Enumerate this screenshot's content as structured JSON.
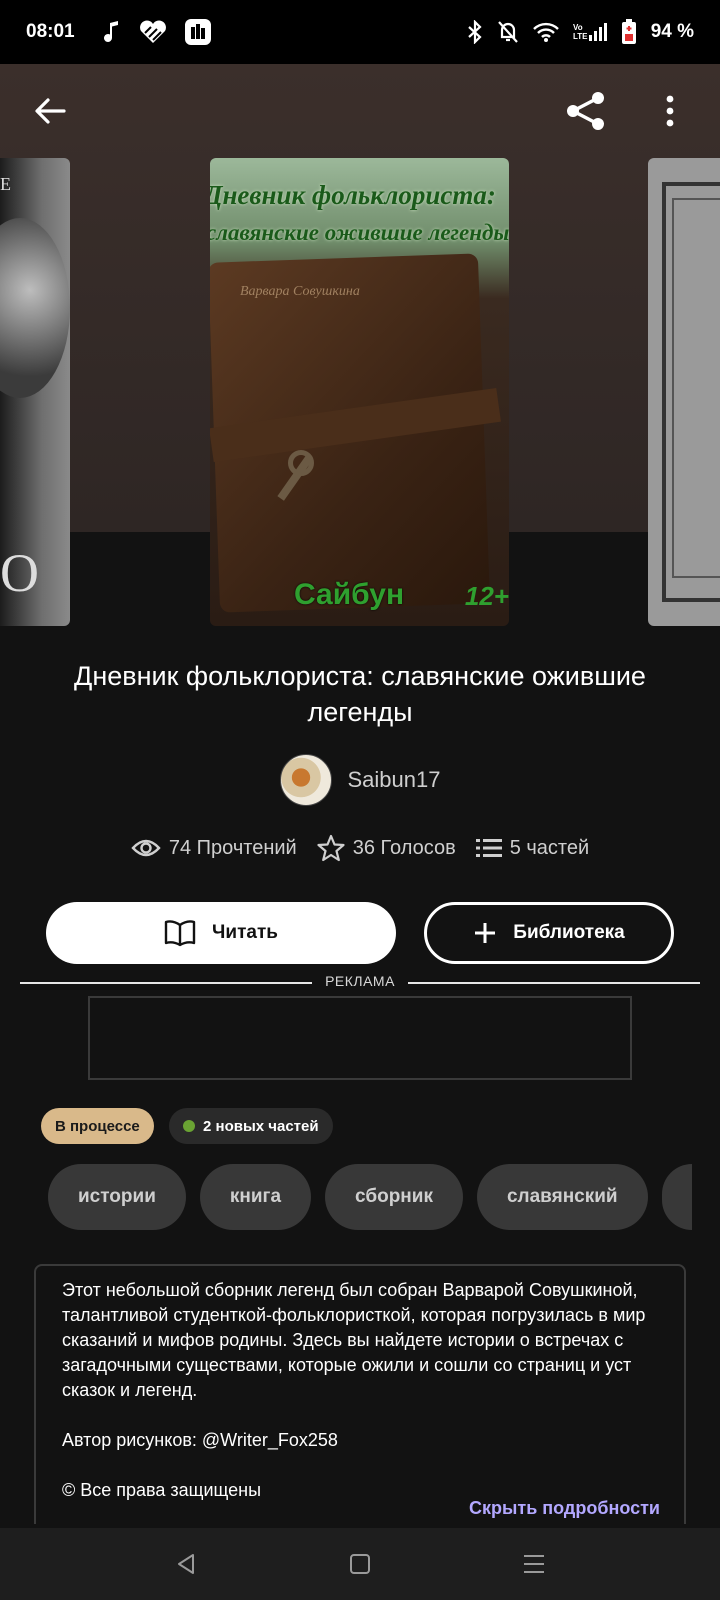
{
  "status_bar": {
    "time": "08:01",
    "battery": "94 %"
  },
  "toolbar": {
    "back_icon": "arrow-left-icon",
    "share_icon": "share-icon",
    "more_icon": "more-vert-icon"
  },
  "covers": {
    "left": {
      "letter_top": "E",
      "letter_bottom": "O"
    },
    "main": {
      "title_line1": "Дневник фольклориста:",
      "title_line2": "славянские ожившие легенды",
      "signature": "Варвара Совушкина",
      "author_text": "Сайбун",
      "age_rating": "12+"
    }
  },
  "story": {
    "title": "Дневник фольклориста: славянские ожившие легенды",
    "author": "Saibun17",
    "reads": "74 Прочтений",
    "votes": "36 Голосов",
    "parts": "5 частей"
  },
  "actions": {
    "read_label": "Читать",
    "library_label": "Библиотека"
  },
  "ad": {
    "label": "РЕКЛАМА"
  },
  "badges": {
    "status": "В процессе",
    "new_parts": "2 новых частей",
    "new_dot_color": "#6aa333"
  },
  "tags": [
    "истории",
    "книга",
    "сборник",
    "славянский"
  ],
  "description": {
    "paragraph1": "Этот небольшой сборник легенд был собран Варварой Совушкиной, талантливой студенткой-фольклористкой, которая погрузилась в мир сказаний и мифов родины. Здесь вы найдете истории о встречах с загадочными существами, которые ожили и сошли со страниц и уст сказок и легенд.",
    "paragraph2": "Автор рисунков: @Writer_Fox258",
    "paragraph3": "© Все права защищены",
    "toggle_label": "Скрыть подробности"
  },
  "colors": {
    "background": "#121212",
    "accent_link": "#b3a8ff",
    "badge_progress": "#d9b98a"
  }
}
